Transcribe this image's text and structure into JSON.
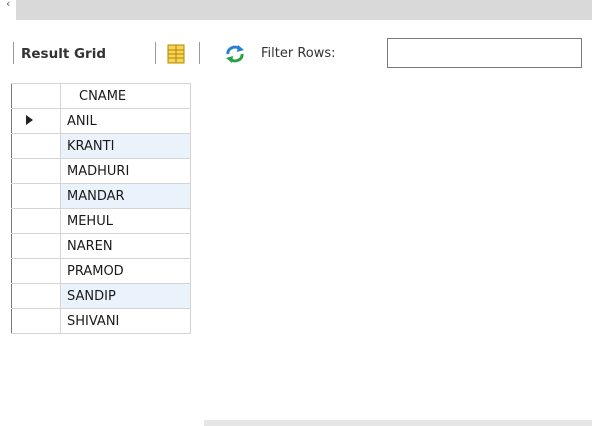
{
  "toolbar": {
    "result_grid_label": "Result Grid",
    "filter_label": "Filter Rows:",
    "filter_value": ""
  },
  "icons": {
    "form_view": "form-editor-icon",
    "refresh": "refresh-icon",
    "selected_row": "current-row-arrow-icon"
  },
  "colors": {
    "alt_row": "#eaf2fb",
    "grid_line": "#d4d4d4"
  },
  "grid": {
    "columns": [
      "CNAME"
    ],
    "rows": [
      "ANIL",
      "KRANTI",
      "MADHURI",
      "MANDAR",
      "MEHUL",
      "NAREN",
      "PRAMOD",
      "SANDIP",
      "SHIVANI"
    ],
    "selected_row_index": 0
  }
}
